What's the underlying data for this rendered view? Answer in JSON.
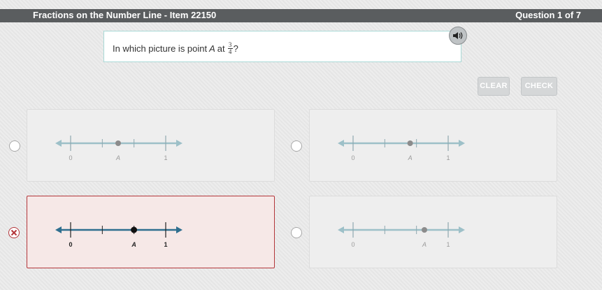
{
  "header": {
    "title": "Fractions on the Number Line - Item 22150",
    "question_counter": "Question 1 of 7"
  },
  "prompt": {
    "text_before": "In which picture is point",
    "variable": "A",
    "text_at": "at",
    "fraction_numerator": "3",
    "fraction_denominator": "4",
    "text_after": "?"
  },
  "audio": {
    "icon": "speaker-icon"
  },
  "buttons": {
    "clear": "CLEAR",
    "check": "CHECK"
  },
  "options": [
    {
      "id": "option-1",
      "label_start": "0",
      "label_point": "A",
      "label_end": "1",
      "point_value": 0.5,
      "state": "unselected"
    },
    {
      "id": "option-2",
      "label_start": "0",
      "label_point": "A",
      "label_end": "1",
      "point_value": 0.6,
      "state": "unselected"
    },
    {
      "id": "option-3",
      "label_start": "0",
      "label_point": "A",
      "label_end": "1",
      "point_value": 0.666,
      "state": "selected-incorrect"
    },
    {
      "id": "option-4",
      "label_start": "0",
      "label_point": "A",
      "label_end": "1",
      "point_value": 0.75,
      "state": "unselected"
    }
  ],
  "colors": {
    "line_inactive": "#9dc0c8",
    "line_active": "#2f6f8f",
    "point_inactive": "#8c8c8c",
    "point_active": "#111111",
    "wrong": "#b3363a"
  }
}
